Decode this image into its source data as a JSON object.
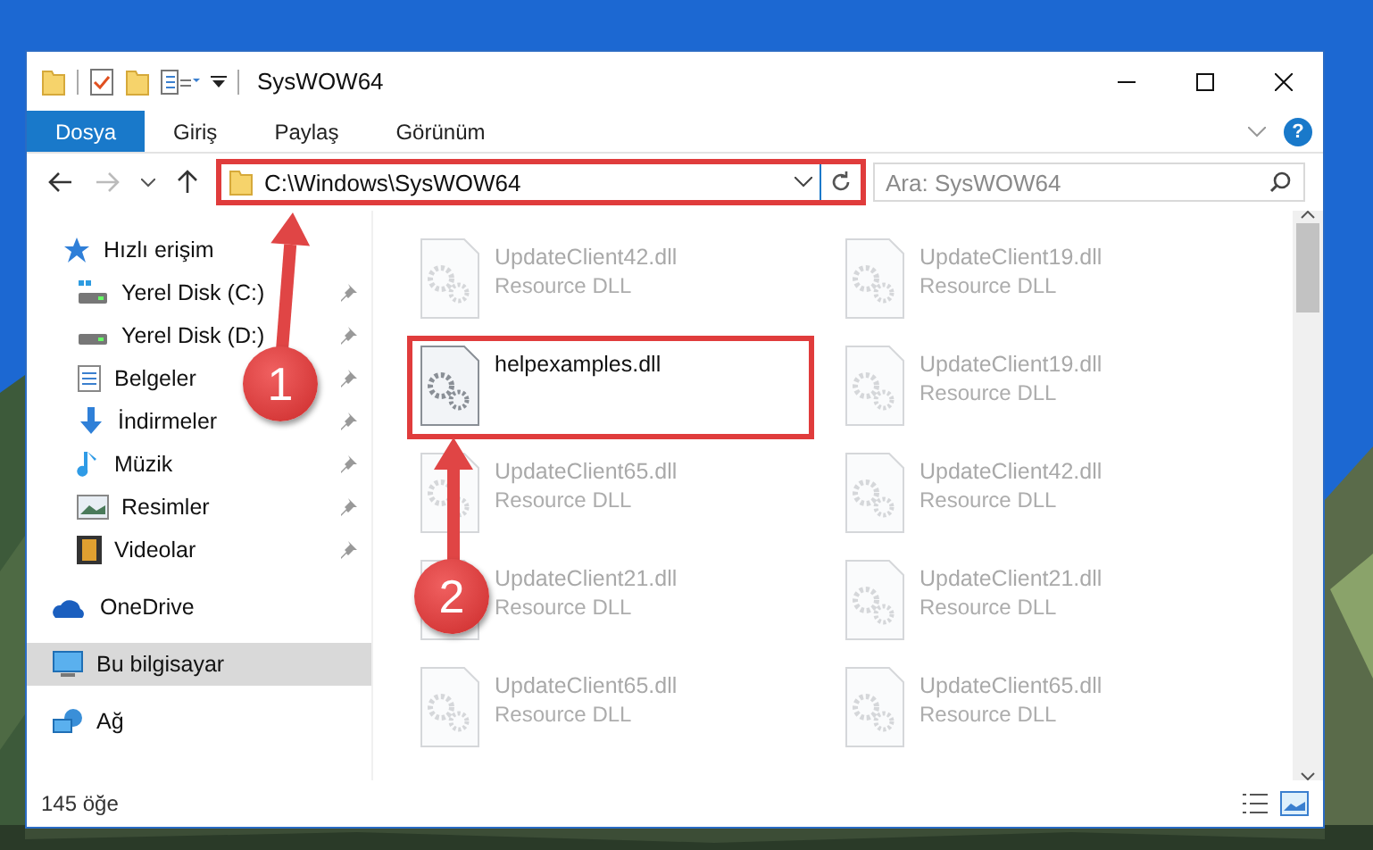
{
  "window": {
    "title": "SysWOW64"
  },
  "ribbon": {
    "tabs": [
      {
        "label": "Dosya",
        "selected": true
      },
      {
        "label": "Giriş",
        "selected": false
      },
      {
        "label": "Paylaş",
        "selected": false
      },
      {
        "label": "Görünüm",
        "selected": false
      }
    ],
    "help": "?"
  },
  "address": {
    "path": "C:\\Windows\\SysWOW64",
    "highlighted": true
  },
  "search": {
    "placeholder": "Ara: SysWOW64"
  },
  "sidebar": {
    "items": [
      {
        "label": "Hızlı erişim",
        "selected": false,
        "children": [
          {
            "label": "Yerel Disk (C:)",
            "selected": false,
            "pinned": true
          },
          {
            "label": "Yerel Disk (D:)",
            "selected": false,
            "pinned": true
          },
          {
            "label": "Belgeler",
            "selected": false,
            "pinned": true
          },
          {
            "label": "İndirmeler",
            "selected": false,
            "pinned": true
          },
          {
            "label": "Müzik",
            "selected": false,
            "pinned": true
          },
          {
            "label": "Resimler",
            "selected": false,
            "pinned": true
          },
          {
            "label": "Videolar",
            "selected": false,
            "pinned": true
          }
        ]
      },
      {
        "label": "OneDrive",
        "selected": false
      },
      {
        "label": "Bu bilgisayar",
        "selected": true
      },
      {
        "label": "Ağ",
        "selected": false
      }
    ]
  },
  "files": [
    {
      "name": "UpdateClient42.dll",
      "type": "Resource DLL",
      "highlighted": false,
      "faded": true
    },
    {
      "name": "UpdateClient19.dll",
      "type": "Resource DLL",
      "highlighted": false,
      "faded": true
    },
    {
      "name": "helpexamples.dll",
      "highlighted": true,
      "faded": false
    },
    {
      "name": "UpdateClient19.dll",
      "type": "Resource DLL",
      "highlighted": false,
      "faded": true
    },
    {
      "name": "UpdateClient65.dll",
      "type": "Resource DLL",
      "highlighted": false,
      "faded": true
    },
    {
      "name": "UpdateClient42.dll",
      "type": "Resource DLL",
      "highlighted": false,
      "faded": true
    },
    {
      "name": "UpdateClient21.dll",
      "type": "Resource DLL",
      "highlighted": false,
      "faded": true
    },
    {
      "name": "UpdateClient21.dll",
      "type": "Resource DLL",
      "highlighted": false,
      "faded": true
    },
    {
      "name": "UpdateClient65.dll",
      "type": "Resource DLL",
      "highlighted": false,
      "faded": true
    },
    {
      "name": "UpdateClient65.dll",
      "type": "Resource DLL",
      "highlighted": false,
      "faded": true
    }
  ],
  "status_bar": {
    "count": "145 öğe"
  },
  "callouts": [
    {
      "number": "1"
    },
    {
      "number": "2"
    }
  ]
}
